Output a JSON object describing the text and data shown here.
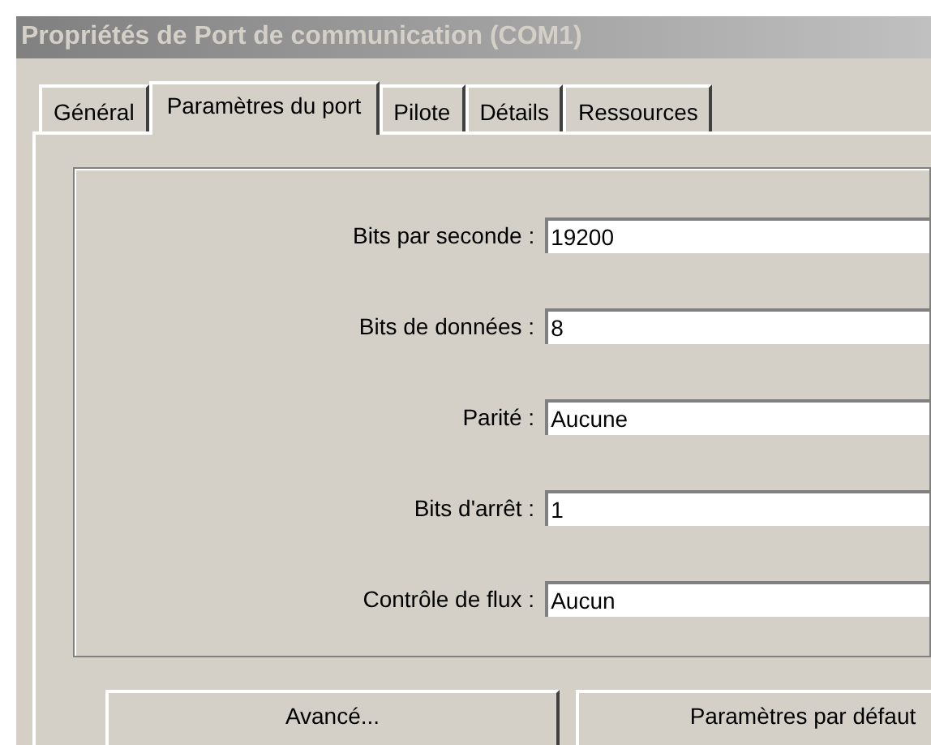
{
  "window": {
    "title": "Propriétés de Port de communication (COM1)"
  },
  "tabs": [
    {
      "label": "Général",
      "selected": false
    },
    {
      "label": "Paramètres du port",
      "selected": true
    },
    {
      "label": "Pilote",
      "selected": false
    },
    {
      "label": "Détails",
      "selected": false
    },
    {
      "label": "Ressources",
      "selected": false
    }
  ],
  "settings": [
    {
      "label": "Bits par seconde :",
      "value": "19200"
    },
    {
      "label": "Bits de données :",
      "value": "8"
    },
    {
      "label": "Parité :",
      "value": "Aucune"
    },
    {
      "label": "Bits d'arrêt :",
      "value": "1"
    },
    {
      "label": "Contrôle de flux :",
      "value": "Aucun"
    }
  ],
  "buttons": [
    "Avancé...",
    "Paramètres par défaut"
  ]
}
